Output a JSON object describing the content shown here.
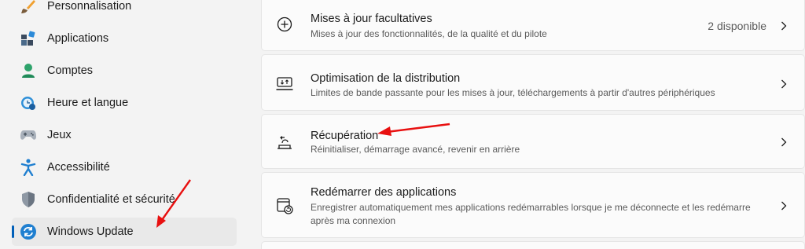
{
  "sidebar": {
    "items": [
      {
        "label": "Personnalisation",
        "icon": "brush-icon"
      },
      {
        "label": "Applications",
        "icon": "apps-icon"
      },
      {
        "label": "Comptes",
        "icon": "person-icon"
      },
      {
        "label": "Heure et langue",
        "icon": "clock-globe-icon"
      },
      {
        "label": "Jeux",
        "icon": "gamepad-icon"
      },
      {
        "label": "Accessibilité",
        "icon": "accessibility-icon"
      },
      {
        "label": "Confidentialité et sécurité",
        "icon": "shield-icon"
      },
      {
        "label": "Windows Update",
        "icon": "update-icon",
        "active": true
      }
    ]
  },
  "cards": [
    {
      "title": "Mises à jour facultatives",
      "subtitle": "Mises à jour des fonctionnalités, de la qualité et du pilote",
      "right_text": "2 disponible",
      "icon": "plus-circle-icon"
    },
    {
      "title": "Optimisation de la distribution",
      "subtitle": "Limites de bande passante pour les mises à jour, téléchargements à partir d'autres périphériques",
      "icon": "delivery-optimization-icon"
    },
    {
      "title": "Récupération",
      "subtitle": "Réinitialiser, démarrage avancé, revenir en arrière",
      "icon": "recovery-icon"
    },
    {
      "title": "Redémarrer des applications",
      "subtitle": "Enregistrer automatiquement mes applications redémarrables lorsque je me déconnecte et les redémarre après ma connexion",
      "icon": "restart-apps-icon"
    }
  ],
  "colors": {
    "accent": "#005fb8",
    "annotation_arrow": "#e81010"
  }
}
